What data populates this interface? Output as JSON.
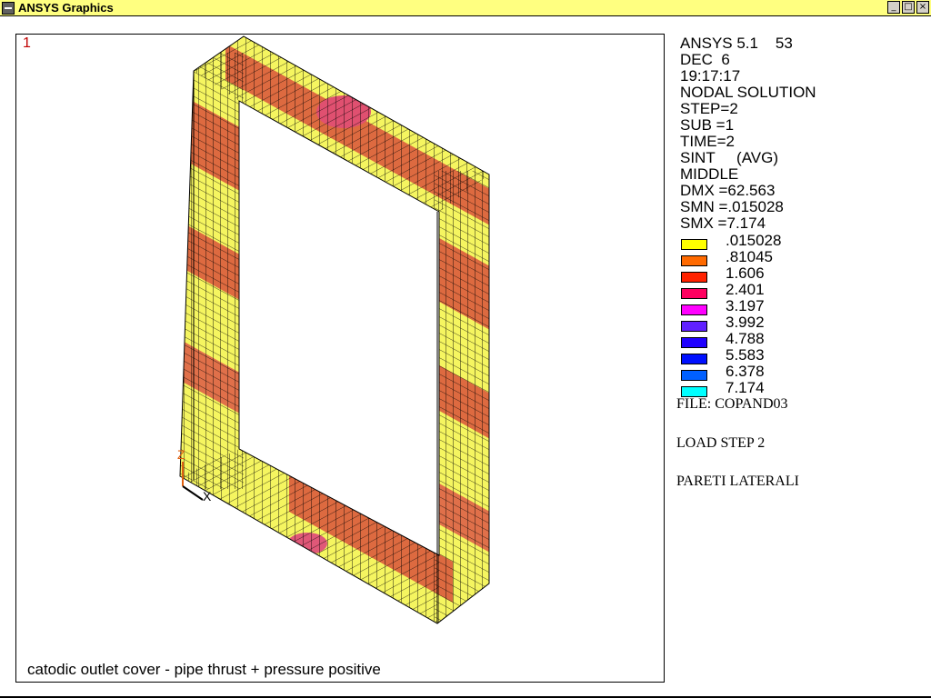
{
  "window": {
    "title": "ANSYS Graphics",
    "buttons": [
      "_",
      "□",
      "×"
    ]
  },
  "viewport": {
    "window_number": "1",
    "caption": "catodic outlet cover - pipe thrust + pressure positive",
    "triad": {
      "z_label": "Z",
      "x_label": "X"
    }
  },
  "info": {
    "lines": [
      "ANSYS 5.1    53",
      "DEC  6",
      "19:17:17",
      "NODAL SOLUTION",
      "STEP=2",
      "SUB =1",
      "TIME=2",
      "SINT     (AVG)",
      "MIDDLE",
      "DMX =62.563",
      "SMN =.015028",
      "SMX =7.174"
    ]
  },
  "legend": [
    {
      "value": ".015028",
      "color": "#ffff00"
    },
    {
      "value": ".81045",
      "color": "#ff6a00"
    },
    {
      "value": "1.606",
      "color": "#ff2200"
    },
    {
      "value": "2.401",
      "color": "#ff0060"
    },
    {
      "value": "3.197",
      "color": "#ff00ff"
    },
    {
      "value": "3.992",
      "color": "#6020ff"
    },
    {
      "value": "4.788",
      "color": "#2000ff"
    },
    {
      "value": "5.583",
      "color": "#0010ff"
    },
    {
      "value": "6.378",
      "color": "#0060ff"
    },
    {
      "value": "7.174",
      "color": "#00ffff"
    }
  ],
  "notes": {
    "file": "FILE: COPAND03",
    "load_step": "LOAD STEP 2",
    "title": "PARETI LATERALI"
  },
  "colors": {
    "titlebar": "#ffff80",
    "mesh_line": "#000000",
    "low_stress": "#f5f560",
    "mid_stress": "#dd6a40",
    "high_stress": "#e05070"
  }
}
